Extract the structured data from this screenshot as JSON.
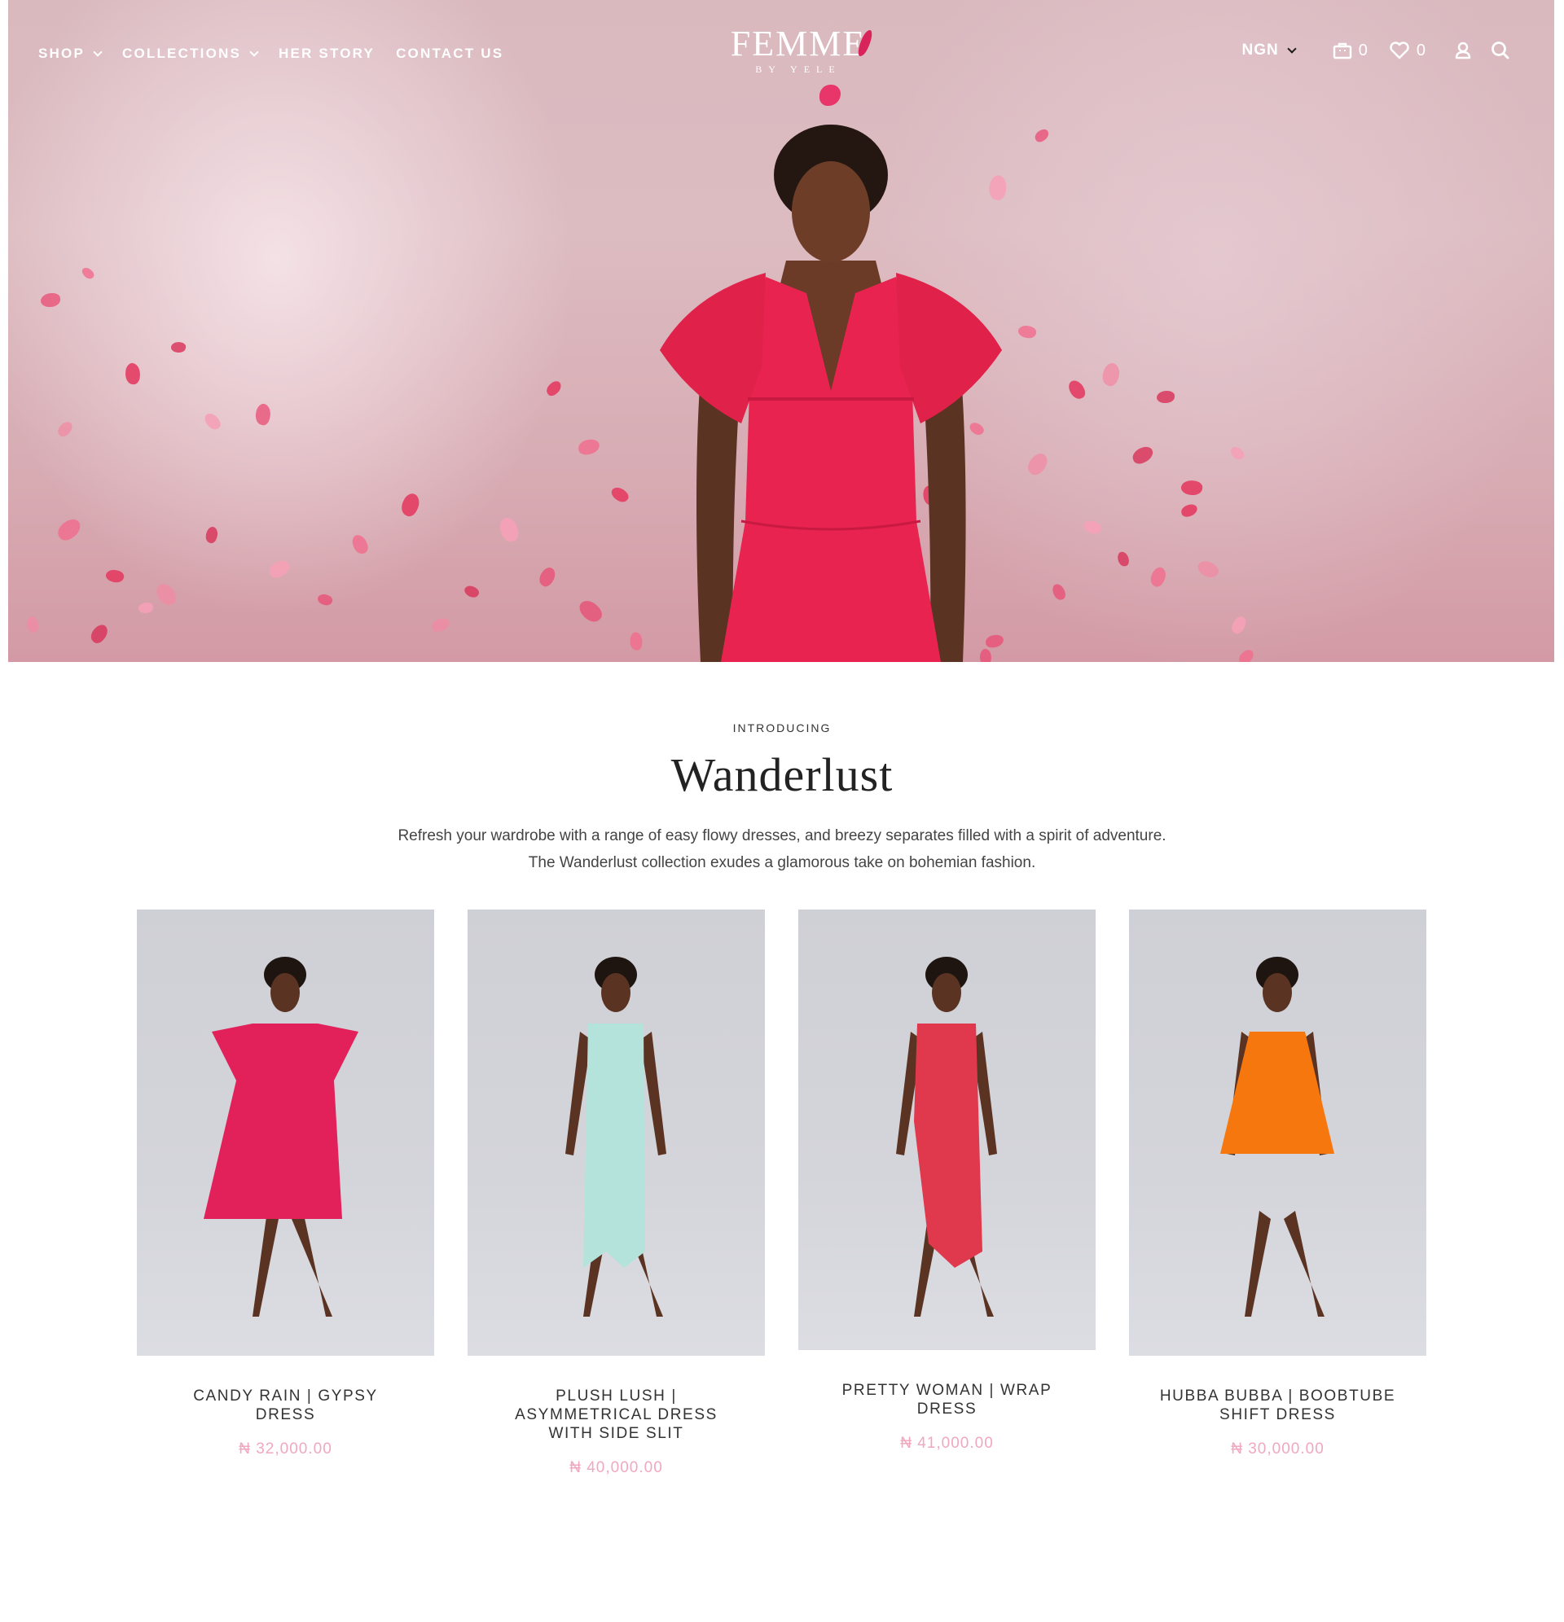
{
  "nav": {
    "shop": "SHOP",
    "collections": "COLLECTIONS",
    "her_story": "HER STORY",
    "contact_us": "CONTACT US"
  },
  "logo": {
    "main": "FEMME",
    "sub": "BY YELE"
  },
  "header_right": {
    "currency": "NGN",
    "cart_count": "0",
    "wishlist_count": "0",
    "icons": [
      "bag-icon",
      "heart-icon",
      "user-icon",
      "search-icon"
    ]
  },
  "intro": {
    "eyebrow": "INTRODUCING",
    "title": "Wanderlust",
    "line1": "Refresh your wardrobe with a range of easy flowy dresses, and breezy separates filled with a spirit of adventure.",
    "line2": "The Wanderlust collection exudes a glamorous take on bohemian fashion."
  },
  "products": [
    {
      "name": "CANDY RAIN | GYPSY DRESS",
      "price": "₦ 32,000.00",
      "dress_color": "#e2205a"
    },
    {
      "name": "PLUSH LUSH | ASYMMETRICAL DRESS WITH SIDE SLIT",
      "price": "₦ 40,000.00",
      "dress_color": "#b4e3dc"
    },
    {
      "name": "PRETTY WOMAN | WRAP DRESS",
      "price": "₦ 41,000.00",
      "dress_color": "#e0394e"
    },
    {
      "name": "HUBBA BUBBA | BOOBTUBE SHIFT DRESS",
      "price": "₦ 30,000.00",
      "dress_color": "#f7770f"
    }
  ],
  "colors": {
    "price": "#f0a8bf",
    "hero_dress": "#e8234f",
    "petals": "#ea4b73"
  }
}
